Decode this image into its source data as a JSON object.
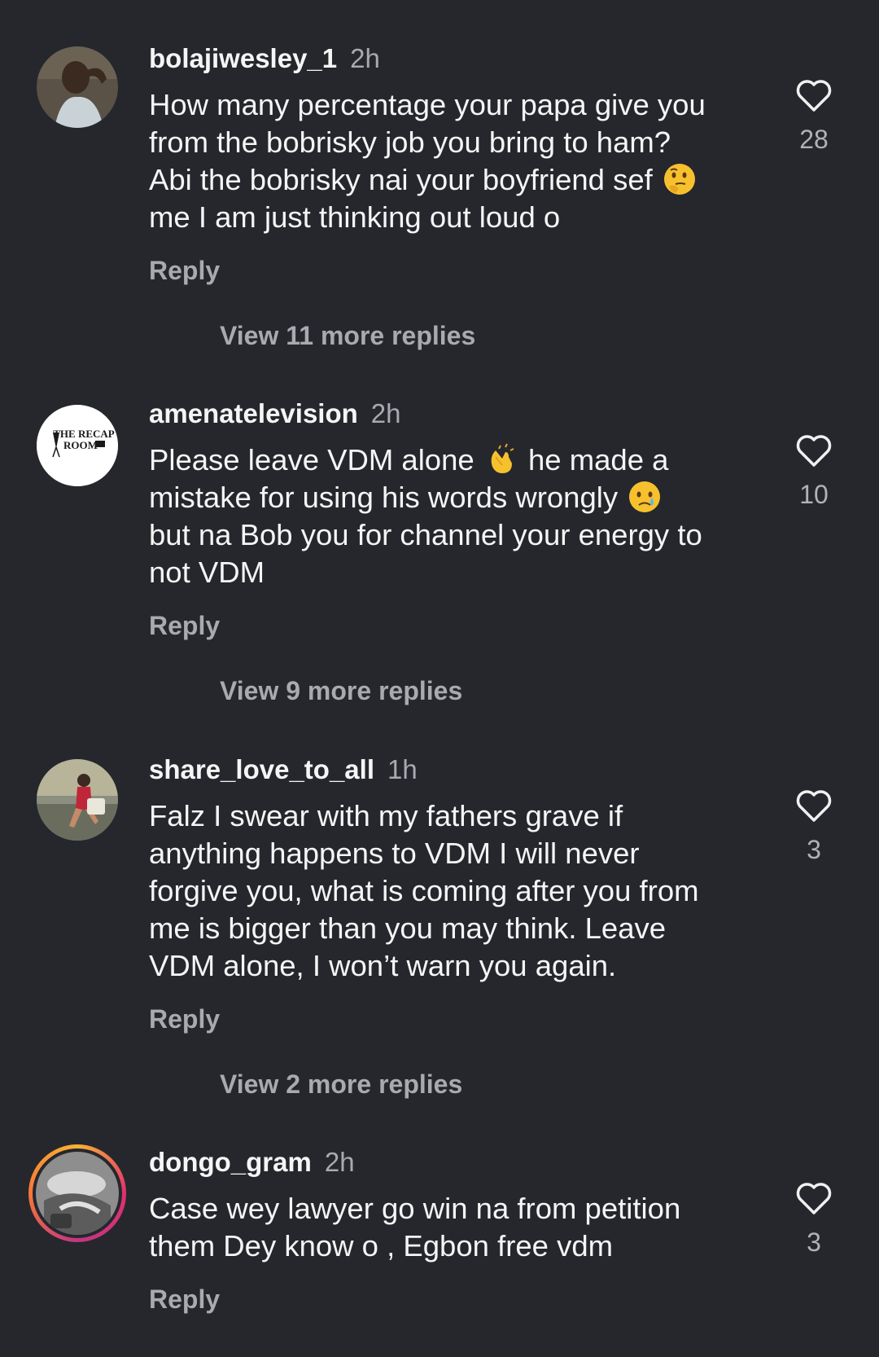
{
  "comments": [
    {
      "username": "bolajiwesley_1",
      "time": "2h",
      "text_parts": [
        "How many percentage your papa give you\nfrom the bobrisky job you bring to ham?\nAbi the bobrisky nai your boyfriend sef ",
        "\nme I am just thinking out loud o"
      ],
      "emoji": "thinking-face",
      "reply_label": "Reply",
      "likes": "28",
      "view_more": "View 11 more replies"
    },
    {
      "username": "amenatelevision",
      "time": "2h",
      "avatar_text": "THE RECAP\nROOM",
      "text_parts": [
        "Please leave VDM alone ",
        " he made a\nmistake for using his words wrongly ",
        "\nbut na Bob you for channel your energy to\nnot VDM"
      ],
      "emojis": [
        "clapping-hands",
        "crying-face"
      ],
      "reply_label": "Reply",
      "likes": "10",
      "view_more": "View 9 more replies"
    },
    {
      "username": "share_love_to_all",
      "time": "1h",
      "text": "Falz I swear with my fathers grave if\nanything happens to VDM I will never\nforgive you, what is coming after you from\nme is bigger than you may think. Leave\nVDM alone, I won’t warn you again.",
      "reply_label": "Reply",
      "likes": "3",
      "view_more": "View 2 more replies"
    },
    {
      "username": "dongo_gram",
      "time": "2h",
      "text": "Case wey lawyer go win na from petition\nthem Dey know o , Egbon free vdm",
      "reply_label": "Reply",
      "likes": "3"
    }
  ],
  "colors": {
    "background": "#25272d",
    "muted": "#a8aab0",
    "text": "#f5f5f5"
  }
}
